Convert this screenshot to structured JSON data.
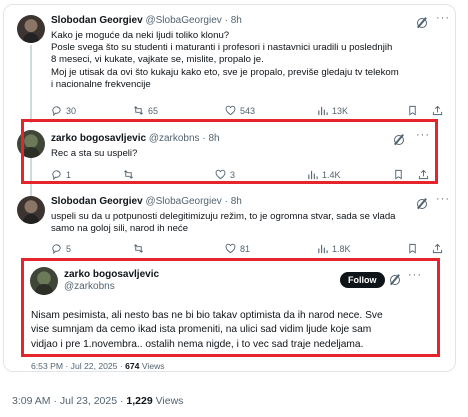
{
  "tweets": [
    {
      "name": "Slobodan Georgiev",
      "handle": "@SlobaGeorgiev",
      "time": "8h",
      "lines": [
        "Kako je moguće da neki ljudi toliko klonu?",
        "Posle svega što su studenti i maturanti i profesori i nastavnici uradili u poslednjih",
        "8 meseci, vi kukate, vajkate se, mislite, propalo je.",
        "Moj je utisak da ovi što kukaju kako eto, sve je propalo, previše gledaju tv telekom",
        "i nacionalne frekvencije"
      ],
      "replies": "30",
      "reposts": "65",
      "likes": "543",
      "views": "13K"
    },
    {
      "name": "zarko bogosavljevic",
      "handle": "@zarkobns",
      "time": "8h",
      "lines": [
        "Rec a sta su uspeli?"
      ],
      "replies": "1",
      "reposts": "",
      "likes": "3",
      "views": "1.4K"
    },
    {
      "name": "Slobodan Georgiev",
      "handle": "@SlobaGeorgiev",
      "time": "8h",
      "lines": [
        "uspeli su da u potpunosti delegitimizuju režim, to je ogromna stvar, sada se vlada",
        "samo na goloj sili, narod ih neće"
      ],
      "replies": "5",
      "reposts": "",
      "likes": "81",
      "views": "1.8K"
    }
  ],
  "main_tweet": {
    "name": "zarko bogosavljevic",
    "handle": "@zarkobns",
    "follow_label": "Follow",
    "lines": [
      "Nisam pesimista, ali nesto bas ne bi bio takav optimista da ih narod nece. Sve",
      "vise sumnjam da cemo ikad ista promeniti, na ulici sad vidim ljude koje sam",
      "vidjao i pre 1.novembra.. ostalih nema nigde, i to vec sad traje nedeljama."
    ],
    "meta_time": "6:53 PM · Jul 22, 2025 · ",
    "meta_views_count": "674",
    "meta_views_label": " Views"
  },
  "footer": {
    "time": "3:09 AM · Jul 23, 2025 · ",
    "views_count": "1,229",
    "views_label": " Views"
  },
  "colors": {
    "highlight": "#e5242b",
    "secondary_text": "#536471"
  }
}
